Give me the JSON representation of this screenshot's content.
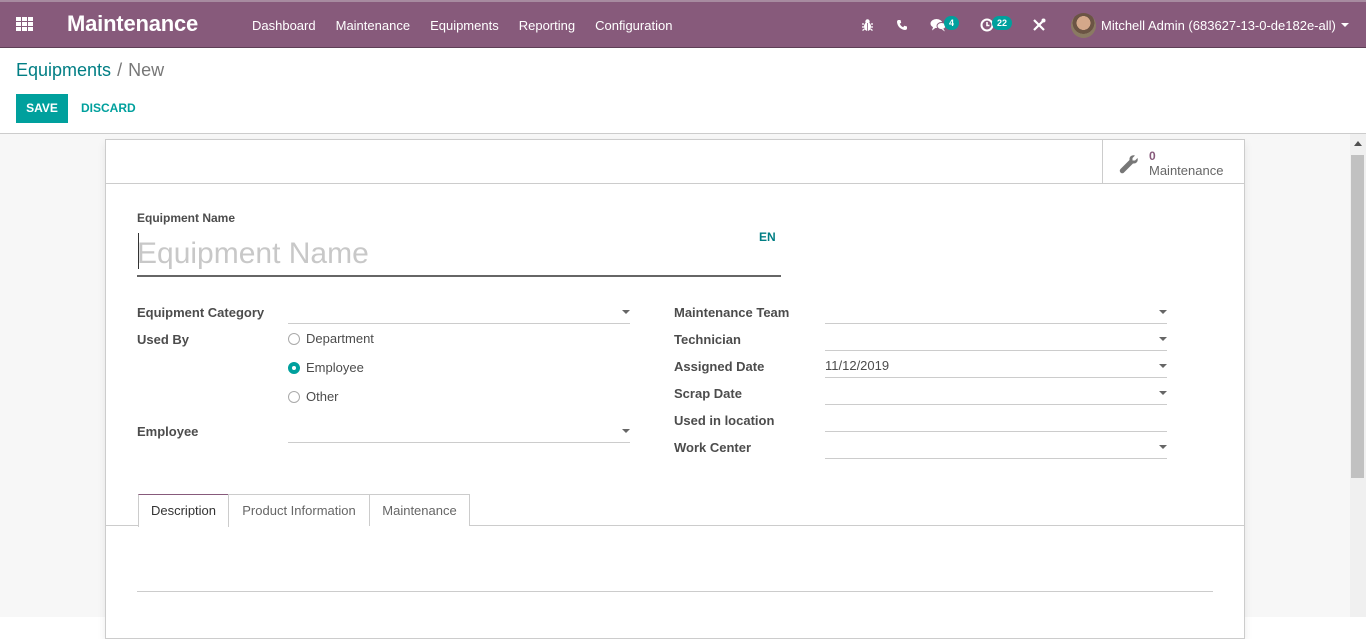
{
  "navbar": {
    "app_title": "Maintenance",
    "menu": [
      "Dashboard",
      "Maintenance",
      "Equipments",
      "Reporting",
      "Configuration"
    ],
    "messages_count": "4",
    "activities_count": "22",
    "user_name": "Mitchell Admin (683627-13-0-de182e-all)"
  },
  "breadcrumb": {
    "parent": "Equipments",
    "separator": "/",
    "current": "New"
  },
  "buttons": {
    "save": "SAVE",
    "discard": "DISCARD"
  },
  "smart_button": {
    "value": "0",
    "label": "Maintenance"
  },
  "form": {
    "name_label": "Equipment Name",
    "name_value": "",
    "name_placeholder": "Equipment Name",
    "lang": "EN",
    "left": {
      "category_label": "Equipment Category",
      "category_value": "",
      "used_by_label": "Used By",
      "used_by_options": [
        "Department",
        "Employee",
        "Other"
      ],
      "used_by_selected": "Employee",
      "employee_label": "Employee",
      "employee_value": ""
    },
    "right": {
      "team_label": "Maintenance Team",
      "team_value": "",
      "technician_label": "Technician",
      "technician_value": "",
      "assigned_date_label": "Assigned Date",
      "assigned_date_value": "11/12/2019",
      "scrap_date_label": "Scrap Date",
      "scrap_date_value": "",
      "location_label": "Used in location",
      "location_value": "",
      "work_center_label": "Work Center",
      "work_center_value": ""
    }
  },
  "tabs": [
    "Description",
    "Product Information",
    "Maintenance"
  ],
  "active_tab": "Description",
  "colors": {
    "navbar": "#875a7b",
    "primary": "#00a09d",
    "link": "#017e84"
  }
}
